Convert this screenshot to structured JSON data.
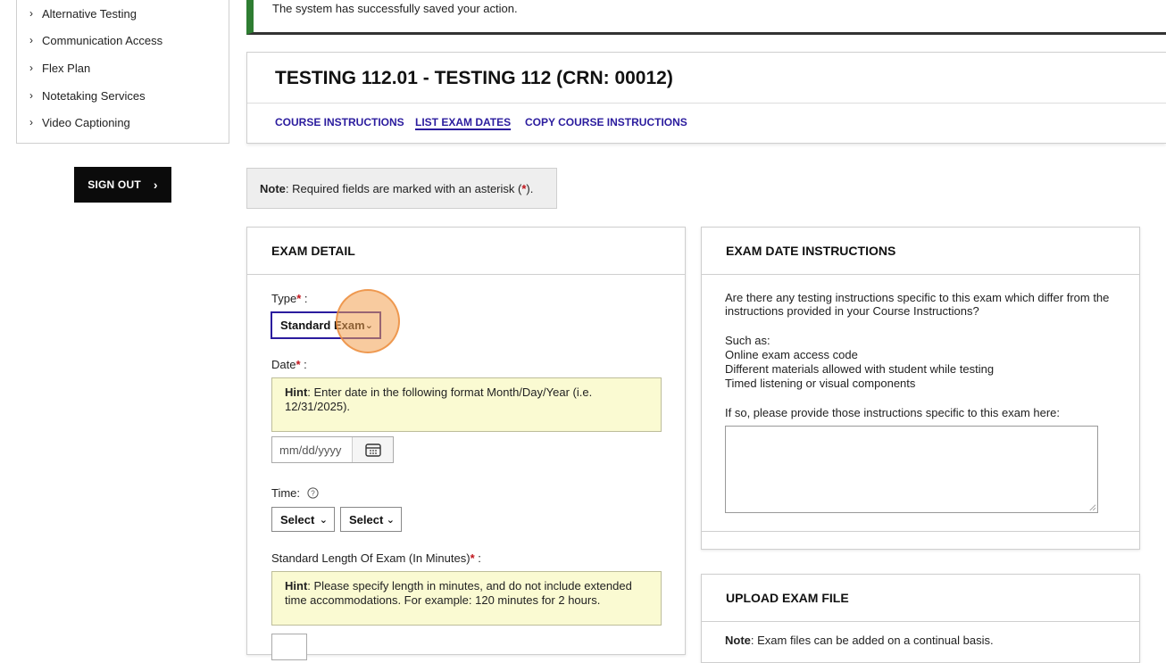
{
  "sidebar": {
    "items": [
      {
        "label": "Alternative Testing",
        "icon": "chevron-right-icon"
      },
      {
        "label": "Communication Access",
        "icon": "chevron-right-icon"
      },
      {
        "label": "Flex Plan",
        "icon": "chevron-right-icon"
      },
      {
        "label": "Notetaking Services",
        "icon": "chevron-right-icon"
      },
      {
        "label": "Video Captioning",
        "icon": "chevron-right-icon"
      }
    ],
    "signout_label": "SIGN OUT"
  },
  "alert": {
    "message": "The system has successfully saved your action.",
    "color": "#2e7d32"
  },
  "course": {
    "title": "TESTING 112.01 - TESTING 112 (CRN: 00012)",
    "links": {
      "course_instructions": "COURSE INSTRUCTIONS",
      "list_exam_dates": "LIST EXAM DATES",
      "copy_course_instructions": "COPY COURSE INSTRUCTIONS"
    }
  },
  "note": {
    "prefix": "Note",
    "text": ": Required fields are marked with an asterisk (",
    "asterisk": "*",
    "suffix": ")."
  },
  "exam_detail": {
    "header": "EXAM DETAIL",
    "type_label": "Type",
    "type_value": "Standard Exam",
    "date_label": "Date",
    "date_hint_prefix": "Hint",
    "date_hint_text": ": Enter date in the following format Month/Day/Year (i.e. 12/31/2025).",
    "date_placeholder": "mm/dd/yyyy",
    "time_label": "Time:",
    "time_hour": "Select",
    "time_minute": "Select",
    "length_label": "Standard Length Of Exam (In Minutes)",
    "length_hint_prefix": "Hint",
    "length_hint_text": ": Please specify length in minutes, and do not include extended time accommodations. For example: 120 minutes for 2 hours."
  },
  "exam_date_instructions": {
    "header": "EXAM DATE INSTRUCTIONS",
    "question": "Are there any testing instructions specific to this exam which differ from the instructions provided in your Course Instructions?",
    "such_as": "Such as:",
    "example_1": "Online exam access code",
    "example_2": "Different materials allowed with student while testing",
    "example_3": "Timed listening or visual components",
    "prompt": "If so, please provide those instructions specific to this exam here:"
  },
  "upload": {
    "header": "UPLOAD EXAM FILE",
    "note_prefix": "Note",
    "note_text": ": Exam files can be added on a continual basis."
  },
  "required_marker": "*",
  "colors": {
    "link": "#2b1c9e",
    "required": "#c0141b",
    "hint_bg": "#fafad2",
    "success": "#2e7d32"
  }
}
